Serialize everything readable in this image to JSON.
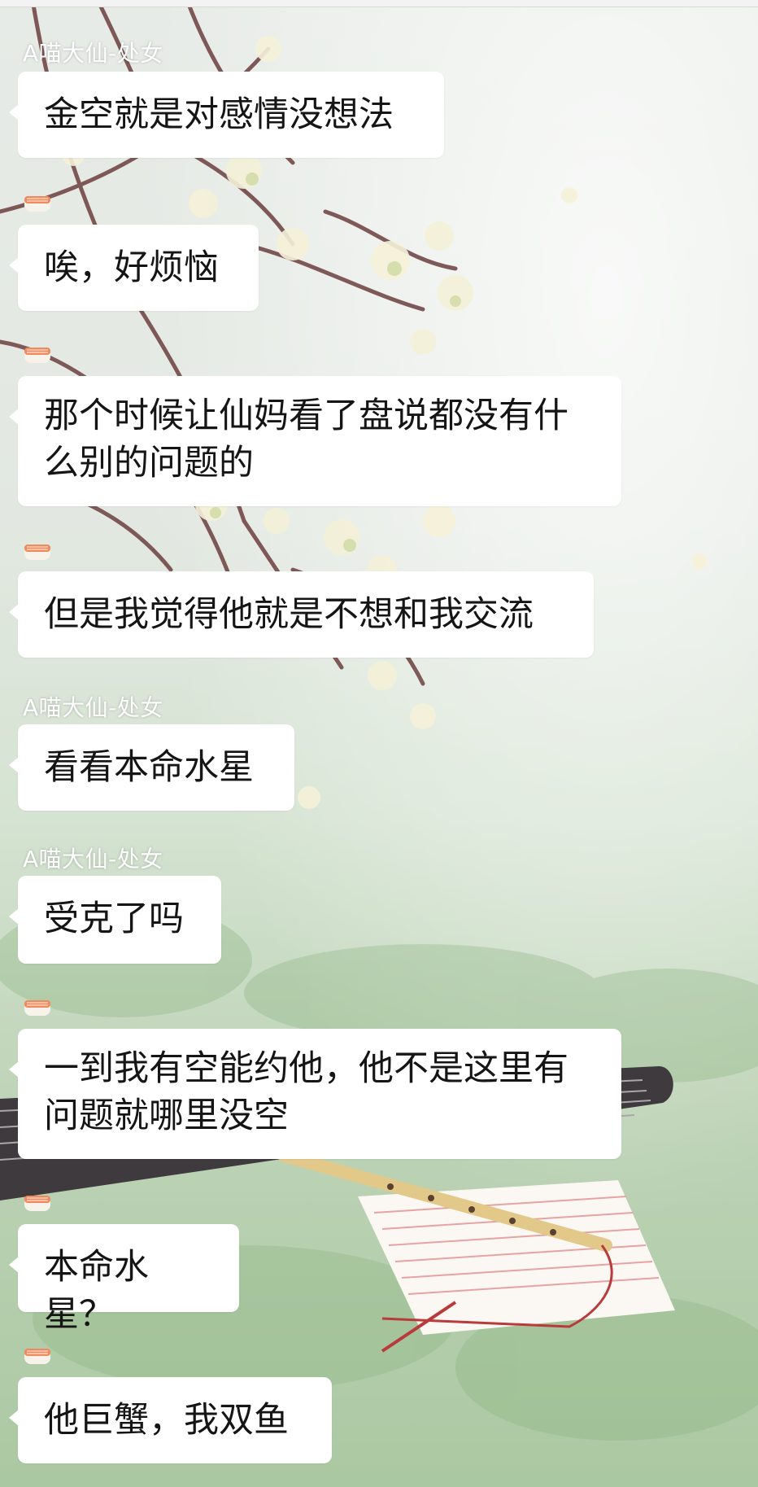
{
  "chat": {
    "messages": [
      {
        "sender": "A喵大仙-处女",
        "text": "金空就是对感情没想法"
      },
      {
        "sender": "",
        "avatar_icon": "sushi-avatar-icon",
        "text": "唉，好烦恼"
      },
      {
        "sender": "",
        "avatar_icon": "sushi-avatar-icon",
        "text": "那个时候让仙妈看了盘说都没有什么别的问题的"
      },
      {
        "sender": "",
        "avatar_icon": "sushi-avatar-icon",
        "text": "但是我觉得他就是不想和我交流"
      },
      {
        "sender": "A喵大仙-处女",
        "text": "看看本命水星"
      },
      {
        "sender": "A喵大仙-处女",
        "text": "受克了吗"
      },
      {
        "sender": "",
        "avatar_icon": "sushi-avatar-icon",
        "text": "一到我有空能约他，他不是这里有问题就哪里没空"
      },
      {
        "sender": "",
        "avatar_icon": "sushi-avatar-icon",
        "text": "本命水星？"
      },
      {
        "sender": "",
        "avatar_icon": "sushi-avatar-icon",
        "text": "他巨蟹，我双鱼"
      }
    ]
  },
  "colors": {
    "bubble_bg": "#ffffff",
    "sender_name": "#ffffff",
    "message_text": "#151515"
  }
}
